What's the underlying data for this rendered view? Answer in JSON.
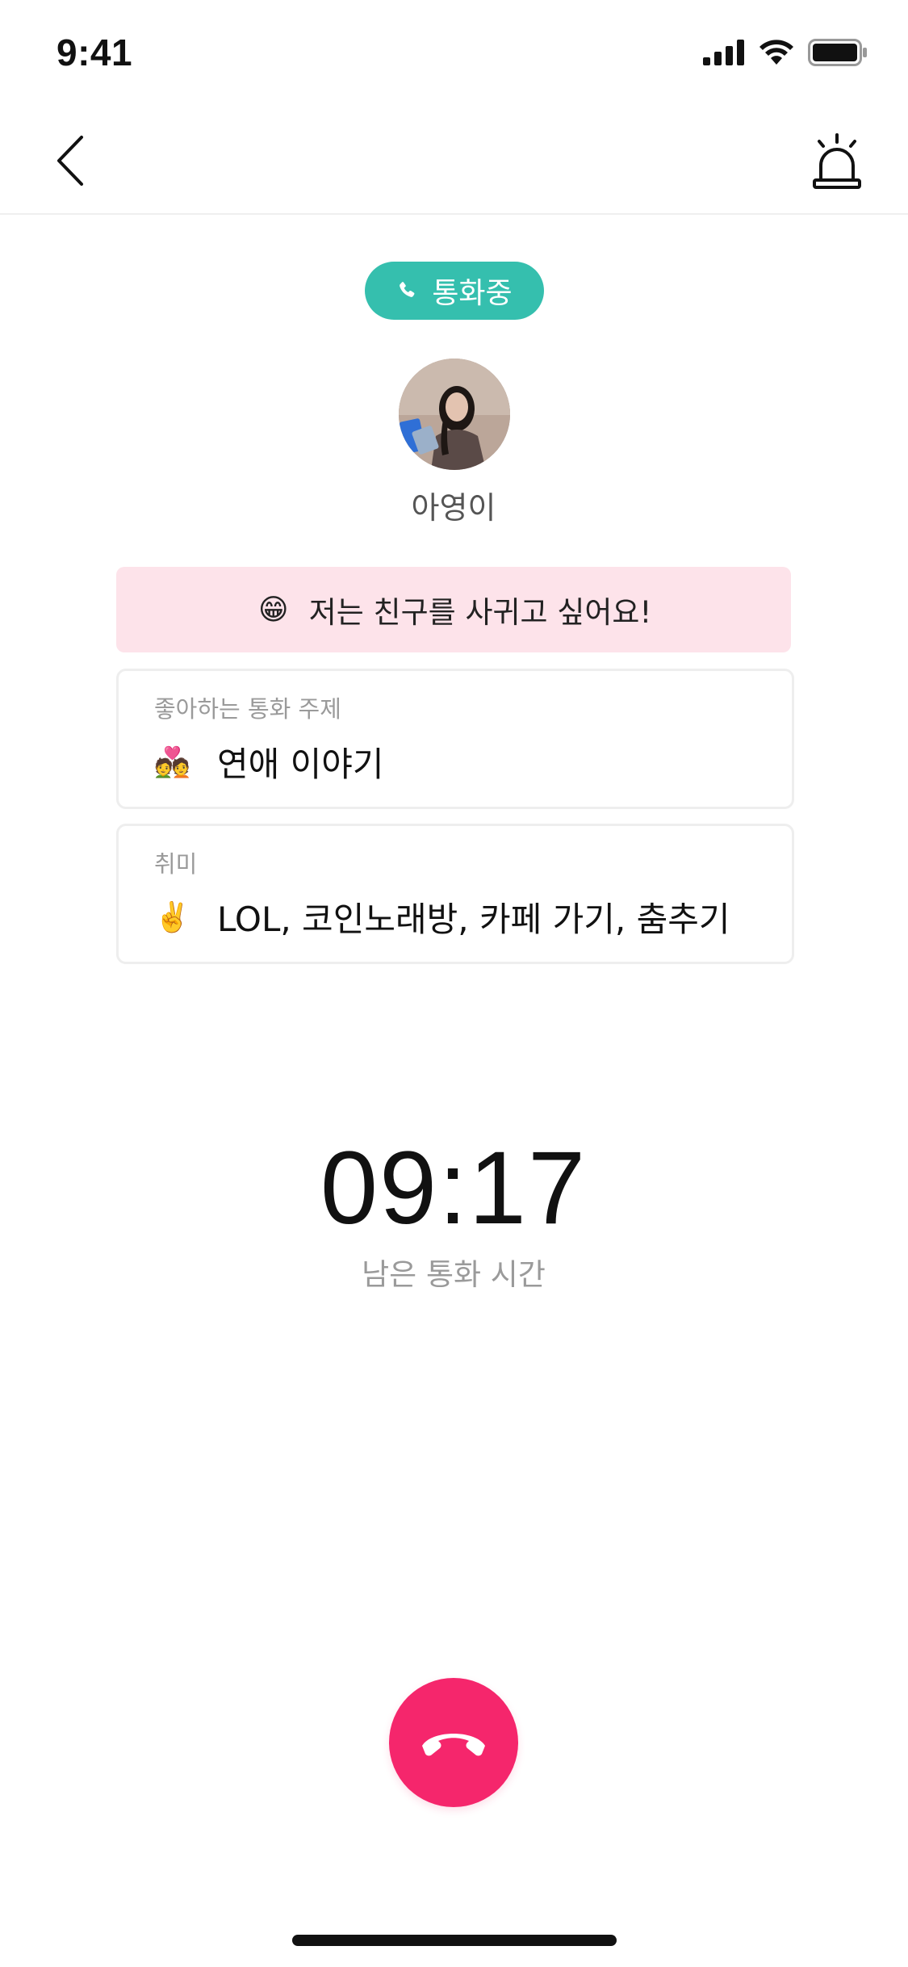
{
  "status_bar": {
    "time": "9:41",
    "icons": [
      "cellular-signal-icon",
      "wifi-icon",
      "battery-icon"
    ]
  },
  "nav": {
    "back_icon": "chevron-left-icon",
    "report_icon": "siren-icon"
  },
  "call_status": {
    "label": "통화중",
    "icon": "phone-icon",
    "color": "#35bfae"
  },
  "user": {
    "name": "아영이",
    "avatar": "profile-photo"
  },
  "intro": {
    "emoji": "😁",
    "text": "저는 친구를 사귀고 싶어요!",
    "background": "#fde3ea"
  },
  "cards": [
    {
      "label": "좋아하는 통화 주제",
      "emoji": "💑",
      "value": "연애 이야기"
    },
    {
      "label": "취미",
      "emoji": "✌️",
      "value": "LOL, 코인노래방, 카페 가기, 춤추기"
    }
  ],
  "timer": {
    "value": "09:17",
    "label": "남은 통화 시간"
  },
  "end_call": {
    "icon": "hang-up-icon",
    "color": "#f5266c"
  }
}
